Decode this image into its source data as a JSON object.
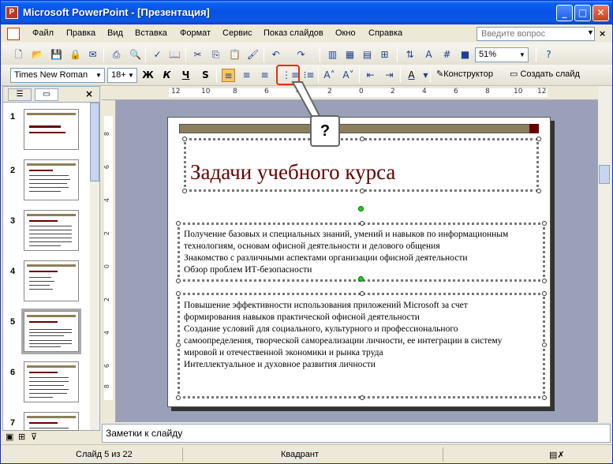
{
  "window": {
    "title": "Microsoft PowerPoint - [Презентация]"
  },
  "menu": [
    "Файл",
    "Правка",
    "Вид",
    "Вставка",
    "Формат",
    "Сервис",
    "Показ слайдов",
    "Окно",
    "Справка"
  ],
  "help_placeholder": "Введите вопрос",
  "toolbar": {
    "zoom": "51%"
  },
  "format_toolbar": {
    "font": "Times New Roman",
    "size": "18+",
    "bold": "Ж",
    "italic": "К",
    "underline": "Ч",
    "shadow": "S",
    "designer": "Конструктор",
    "new_slide": "Создать слайд"
  },
  "callout": "?",
  "rulers": {
    "h": [
      "12",
      "10",
      "8",
      "6",
      "4",
      "2",
      "0",
      "2",
      "4",
      "6",
      "8",
      "10",
      "12"
    ],
    "v": [
      "8",
      "6",
      "4",
      "2",
      "0",
      "2",
      "4",
      "6",
      "8"
    ]
  },
  "thumbnails": [
    "1",
    "2",
    "3",
    "4",
    "5",
    "6",
    "7"
  ],
  "slide": {
    "title": "Задачи учебного курса",
    "body1": [
      "Получение базовых и специальных знаний, умений и навыков по информационным",
      "технологиям, основам офисной деятельности и делового общения",
      "Знакомство с различными аспектами организации офисной деятельности",
      "Обзор проблем ИТ-безопасности"
    ],
    "body2": [
      "Повышение эффективности использования приложений Microsoft за счет",
      "формирования навыков практической офисной  деятельности",
      "Создание условий для социального, культурного и профессионального",
      "самоопределения, творческой самореализации личности, ее интеграции в систему",
      "мировой и отечественной экономики и рынка труда",
      "Интеллектуальное и духовное развития личности"
    ]
  },
  "notes": "Заметки к слайду",
  "status": {
    "slide": "Слайд 5 из 22",
    "design": "Квадрант"
  }
}
